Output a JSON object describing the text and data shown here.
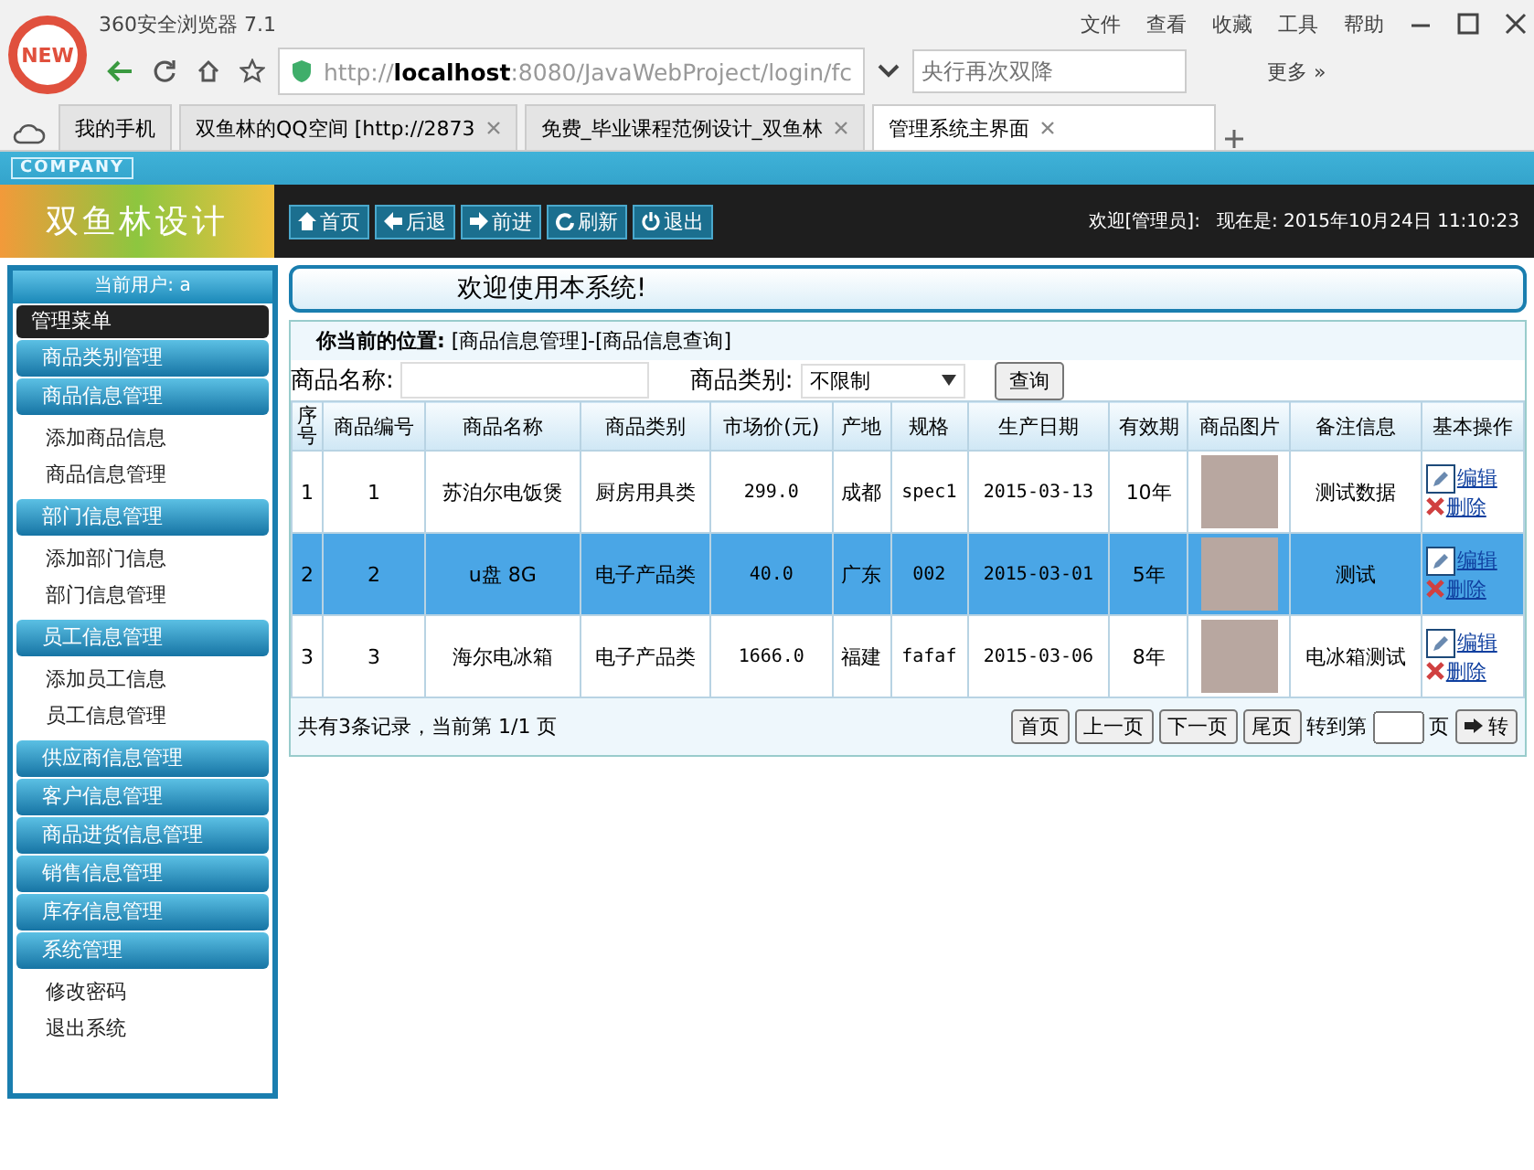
{
  "browser": {
    "badge": "NEW",
    "title": "360安全浏览器 7.1",
    "menu": [
      "文件",
      "查看",
      "收藏",
      "工具",
      "帮助"
    ],
    "url_prefix": "http://",
    "url_host": "localhost",
    "url_rest": ":8080/JavaWebProject/login/fc",
    "search": {
      "placeholder": "央行再次双降"
    },
    "more": "更多 »",
    "tabs": [
      {
        "label": "我的手机",
        "selected": false
      },
      {
        "label": "双鱼林的QQ空间 [http://2873",
        "selected": false
      },
      {
        "label": "免费_毕业课程范例设计_双鱼林",
        "selected": false
      },
      {
        "label": "管理系统主界面",
        "selected": true
      }
    ]
  },
  "header": {
    "company": "COMPANY",
    "logo": "双鱼林设计",
    "nav": [
      "首页",
      "后退",
      "前进",
      "刷新",
      "退出"
    ],
    "welcome": "欢迎[管理员]:",
    "clock": "现在是: 2015年10月24日 11:10:23"
  },
  "sidebar": {
    "current_user": "当前用户: a",
    "menu_title": "管理菜单",
    "groups": [
      {
        "label": "商品类别管理"
      },
      {
        "label": "商品信息管理",
        "children": [
          "添加商品信息",
          "商品信息管理"
        ]
      },
      {
        "label": "部门信息管理",
        "children": [
          "添加部门信息",
          "部门信息管理"
        ]
      },
      {
        "label": "员工信息管理",
        "children": [
          "添加员工信息",
          "员工信息管理"
        ]
      },
      {
        "label": "供应商信息管理"
      },
      {
        "label": "客户信息管理"
      },
      {
        "label": "商品进货信息管理"
      },
      {
        "label": "销售信息管理"
      },
      {
        "label": "库存信息管理"
      },
      {
        "label": "系统管理",
        "children": [
          "修改密码",
          "退出系统"
        ]
      }
    ]
  },
  "main": {
    "banner": "欢迎使用本系统!",
    "location_label": "你当前的位置:",
    "location": "[商品信息管理]-[商品信息查询]",
    "search": {
      "name_label": "商品名称:",
      "category_label": "商品类别:",
      "category_value": "不限制",
      "button": "查询"
    },
    "table": {
      "columns": [
        "序号",
        "商品编号",
        "商品名称",
        "商品类别",
        "市场价(元)",
        "产地",
        "规格",
        "生产日期",
        "有效期",
        "商品图片",
        "备注信息",
        "基本操作"
      ],
      "rows": [
        {
          "selected": false,
          "cells": [
            "1",
            "1",
            "苏泊尔电饭煲",
            "厨房用具类",
            "299.0",
            "成都",
            "spec1",
            "2015-03-13",
            "10年"
          ],
          "note": "测试数据",
          "actions": [
            "编辑",
            "删除"
          ]
        },
        {
          "selected": true,
          "cells": [
            "2",
            "2",
            "u盘 8G",
            "电子产品类",
            "40.0",
            "广东",
            "002",
            "2015-03-01",
            "5年"
          ],
          "note": "测试",
          "actions": [
            "编辑",
            "删除"
          ]
        },
        {
          "selected": false,
          "cells": [
            "3",
            "3",
            "海尔电冰箱",
            "电子产品类",
            "1666.0",
            "福建",
            "fafaf",
            "2015-03-06",
            "8年"
          ],
          "note": "电冰箱测试",
          "actions": [
            "编辑",
            "删除"
          ]
        }
      ]
    },
    "pager": {
      "summary": "共有3条记录，当前第 1/1 页",
      "buttons": [
        "首页",
        "上一页",
        "下一页",
        "尾页"
      ],
      "goto_label": "转到第",
      "page_unit": "页",
      "go": "转"
    }
  }
}
